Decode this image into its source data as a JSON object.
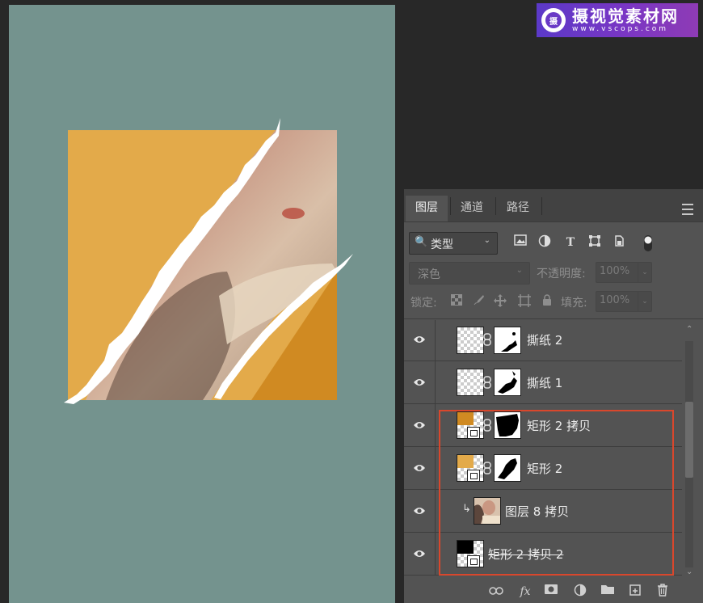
{
  "watermark": {
    "brand": "摄视觉素材网",
    "domain": "www.vscops.com",
    "badge_glyph": "摄"
  },
  "colors": {
    "canvas_bg": "#74938e",
    "orange_light": "#e3aa4a",
    "orange_dark": "#d08a22",
    "highlight_box": "#d9472c",
    "panel_bg": "#535353"
  },
  "layers_panel": {
    "tabs": [
      {
        "label": "图层",
        "active": true
      },
      {
        "label": "通道",
        "active": false
      },
      {
        "label": "路径",
        "active": false
      }
    ],
    "filter": {
      "search_glyph": "🔍",
      "kind_label": "类型",
      "chevron": "⌄",
      "icons": [
        "image-filter-icon",
        "adjustment-filter-icon",
        "type-filter-icon",
        "shape-filter-icon",
        "smart-object-filter-icon",
        "filter-toggle-icon"
      ]
    },
    "blend_mode": "深色",
    "opacity_label": "不透明度:",
    "opacity_value": "100%",
    "lock_label": "锁定:",
    "fill_label": "填充:",
    "fill_value": "100%",
    "layers": [
      {
        "name": "撕纸 2",
        "type": "masked-layer",
        "visible": true
      },
      {
        "name": "撕纸 1",
        "type": "masked-layer",
        "visible": true
      },
      {
        "name": "矩形 2 拷贝",
        "type": "shape-masked",
        "visible": true
      },
      {
        "name": "矩形 2",
        "type": "shape-masked",
        "visible": true
      },
      {
        "name": "图层 8 拷贝",
        "type": "clipped-photo",
        "visible": true
      },
      {
        "name": "矩形 2 拷贝 2",
        "type": "shape-disabled",
        "visible": true
      }
    ],
    "bottom_icons": [
      "link-layers-icon",
      "fx-icon",
      "add-mask-icon",
      "adjustment-layer-icon",
      "new-group-icon",
      "new-layer-icon",
      "delete-layer-icon"
    ]
  }
}
